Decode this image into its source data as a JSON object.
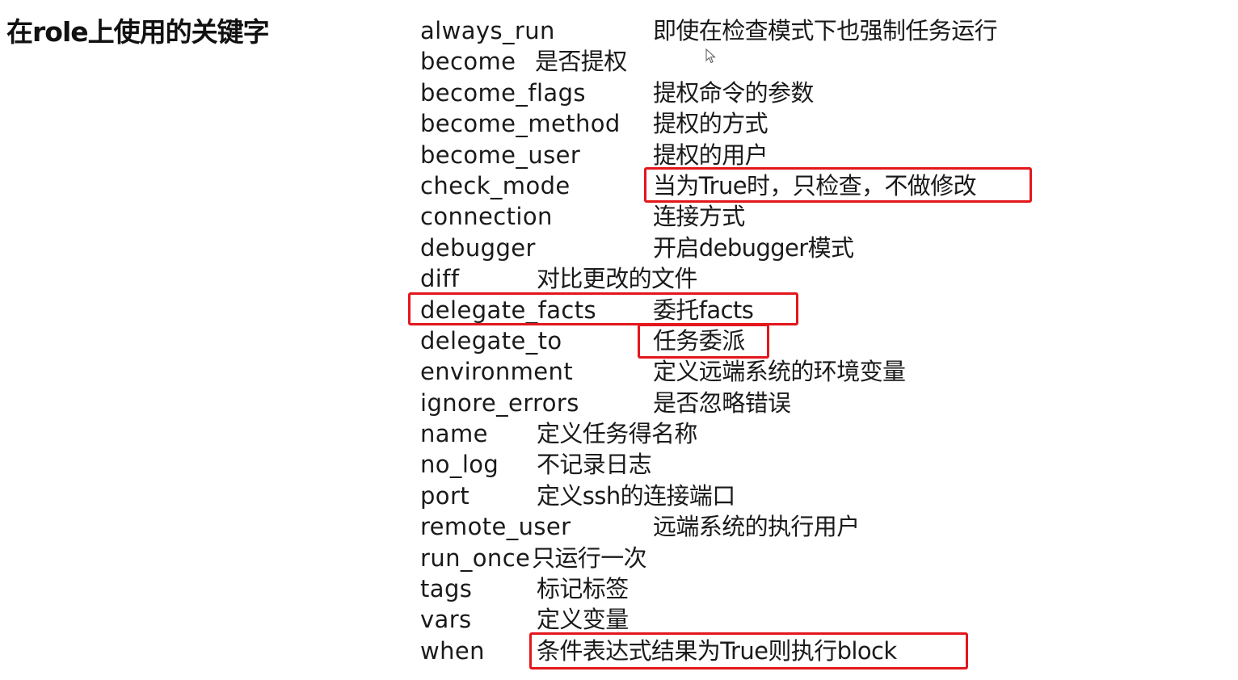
{
  "slide": {
    "title": "在role上使用的关键字",
    "keywords": [
      {
        "keyword": "always_run",
        "description": "即使在检查模式下也强制任务运行"
      },
      {
        "keyword": "become",
        "description": "是否提权"
      },
      {
        "keyword": "become_flags",
        "description": "提权命令的参数"
      },
      {
        "keyword": "become_method",
        "description": "提权的方式"
      },
      {
        "keyword": "become_user",
        "description": "提权的用户"
      },
      {
        "keyword": "check_mode",
        "description": "当为True时，只检查，不做修改"
      },
      {
        "keyword": "connection",
        "description": "连接方式"
      },
      {
        "keyword": "debugger",
        "description": "开启debugger模式"
      },
      {
        "keyword": "diff",
        "description": "对比更改的文件"
      },
      {
        "keyword": "delegate_facts",
        "description": "委托facts"
      },
      {
        "keyword": "delegate_to",
        "description": "任务委派"
      },
      {
        "keyword": "environment",
        "description": "定义远端系统的环境变量"
      },
      {
        "keyword": "ignore_errors",
        "description": "是否忽略错误"
      },
      {
        "keyword": "name",
        "description": "定义任务得名称"
      },
      {
        "keyword": "no_log",
        "description": "不记录日志"
      },
      {
        "keyword": "port",
        "description": "定义ssh的连接端口"
      },
      {
        "keyword": "remote_user",
        "description": "远端系统的执行用户"
      },
      {
        "keyword": "run_once",
        "description": "只运行一次"
      },
      {
        "keyword": "tags",
        "description": "标记标签"
      },
      {
        "keyword": "vars",
        "description": "定义变量"
      },
      {
        "keyword": "when",
        "description": "条件表达式结果为True则执行block"
      }
    ],
    "highlight_color": "#e3171c"
  }
}
